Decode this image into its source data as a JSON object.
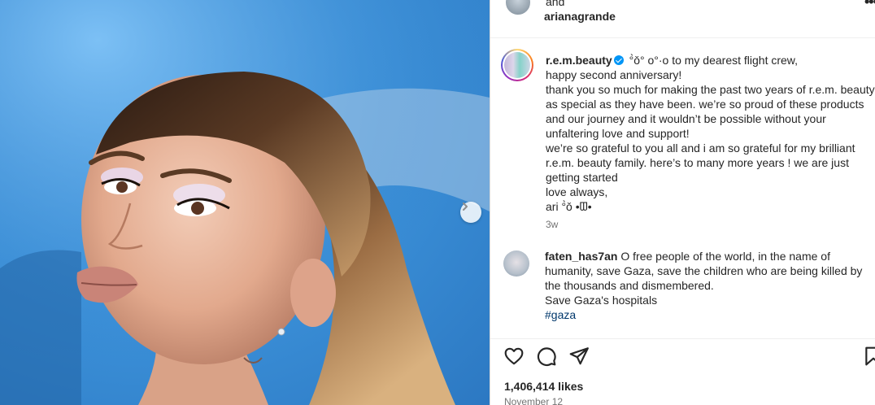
{
  "header": {
    "collab_text": "and",
    "owner_username": "arianagrande",
    "more_label": "•••"
  },
  "caption": {
    "username": "r.e.m.beauty",
    "verified": true,
    "lines": [
      "°̀ǒ° •ᗵ• to my dearest flight crew,",
      "happy second anniversary!",
      "thank you so much for making the past two years of r.e.m. beauty",
      "as special as they have been. we’re so proud of these products",
      "and our journey and it wouldn’t be possible without your",
      "unfaltering love and support!",
      "we’re so grateful to you all and i am so grateful for my brilliant",
      "r.e.m. beauty family. here’s to many more years ! we are just",
      "getting started",
      "love always,",
      "ari °̀ǒ •ᗵ•"
    ],
    "first_line_after_name": "°̀ǒ° o°·o to my dearest flight crew,",
    "time": "3w"
  },
  "comment": {
    "username": "faten_has7an",
    "lines": [
      "O free people of the world, in the name of",
      "humanity, save Gaza, save the children who are being killed by",
      "the thousands and dismembered.",
      "Save Gaza's hospitals"
    ],
    "hashtag": "#gaza"
  },
  "actions": {
    "like_icon": "heart-icon",
    "comment_icon": "comment-icon",
    "share_icon": "share-icon",
    "save_icon": "bookmark-icon"
  },
  "likes": "1,406,414 likes",
  "date": "November 12",
  "colors": {
    "verified": "#0095f6",
    "hashtag": "#00376b",
    "muted": "#737373",
    "media_bg": "#3d93db"
  }
}
